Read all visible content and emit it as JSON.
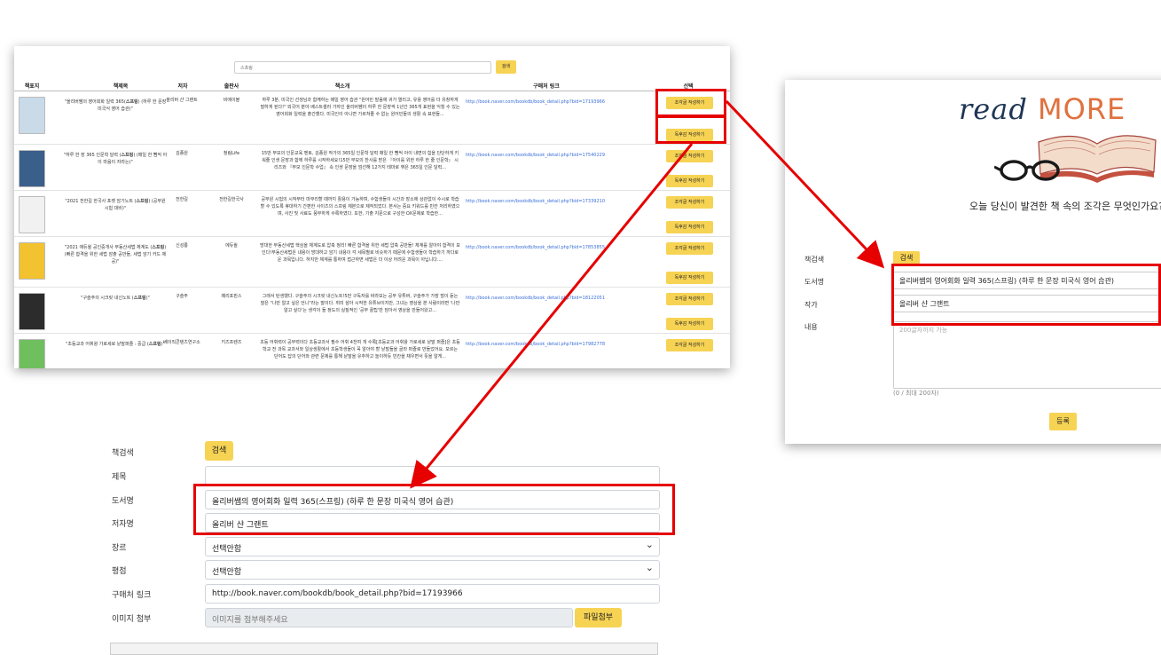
{
  "results": {
    "search_value": "스프링",
    "search_button": "검색",
    "headers": [
      "책표지",
      "책제목",
      "저자",
      "출판사",
      "책소개",
      "구매처 링크",
      "선택"
    ],
    "btn_snippet": "조각글 작성하기",
    "btn_review": "독후감 작성하기",
    "rows": [
      {
        "title": "\"올리버쌤의 영어회화 일력 365(스프링) (하루 한 문장 미국식 영어 습관)\"",
        "author": "올리버 샨 그랜트",
        "publisher": "비에이블",
        "intro": "하루 3분, 미국인 선생님과 함께하는 매일 영어 습관 \"원어민 발음에 귀가 열리고, 유용 영어를 더 유창하게 말하게 된다!\" 외국어 분야 베스트셀러 가자인 올리버쌤이 하루 한 문장씩 1년간 365개 표현을 익힐 수 있는 영어회화 일력을 출간했다. 미국인이 아니면 가르쳐줄 수 없는 원어민들의 생활 속 표현들...",
        "link": "http://book.naver.com/bookdb/book_detail.php?bid=17193966",
        "cover_color": "#c9dbe8"
      },
      {
        "title": "\"하루 한 장 365 인문학 달력 (스프링) (매일 한 뼘씩 아이 마음이 자라는)\"",
        "author": "김종원",
        "publisher": "청림Life",
        "intro": "15만 부모의 인문교육 멘토, 김종원 작가의 365일 인문학 달력 매일 한 뼘씩 아이 내면의 힘을 단단하게 키워줄 인생 문장과 함께 하루를 시작하세요!15만 부모의 찬사를 받은 『아이를 위한 하루 한 줄 인문학』 시리즈와 『부모 인문학 수업』 속 인생 문장을 엄선해 12가지 테마로 엮은 365일 인문 달력...",
        "link": "http://book.naver.com/bookdb/book_detail.php?bid=17540229",
        "cover_color": "#3a5f8a"
      },
      {
        "title": "\"2021 전한길 한국사 포켓 암기노트 (스프링) (공무원 시험 대비)\"",
        "author": "전한길",
        "publisher": "전한길한국사",
        "intro": "공무원 시험의 시작부터 마무리할 때까지 활용이 가능하며, 수험생들이 시간과 장소에 상관없이 수시로 학습할 수 있도록 휴대하기 간편한 사이즈의 스프링 제본으로 제작되었다. 본서는 중요 키워드를 빈칸 처리하였으며, 사진 및 사료도 풍부하게 수록하였다. 또한, 기출 지문으로 구성한 OX문제로 학습한...",
        "link": "http://book.naver.com/bookdb/book_detail.php?bid=17339210",
        "cover_color": "#f1f1f1"
      },
      {
        "title": "\"2021 에듀윌 공인중개사 부동산세법 체계도 (스프링) (빠른 합격을 위한 세법 암출 공만들, 세법 암기 카드 제공)\"",
        "author": "신성룡",
        "publisher": "에듀윌",
        "intro": "방대한 부동산세법 핵심을 체계도로 압축 정리! 빠른 합격을 위한 세법 압축 공만들! 체계를 알아야 합격이 보인다!부동산세법은 내용이 방대하고 암기 내용이 각 세목별로 비슷하기 때문에 수험생들이 학습하기 까다로운 과목입니다. 하지만 체계를 통하여 접근하면 세법은 더 이상 어려운 과목이 아닙니다....",
        "link": "http://book.naver.com/bookdb/book_detail.php?bid=17853855",
        "cover_color": "#f2c230"
      },
      {
        "title": "\"구슬주의 시크릿 내신노트 (스프링)\"",
        "author": "구슬주",
        "publisher": "메리포핀스",
        "intro": "그래서 탄생했다. 구슬주의 시크릿 내신노트!5만 구독자를 바라보는 공부 유튜버, 구슬주가 가장 많이 듣는 말은 \"나만 알고 싶은 언니\"라는 말이다. 취미 삼아 시작한 유튜브이지만, 그녀는 영상을 본 사람이라면 '나만 알고 싶다'는 생각이 들 정도의 실질적인 '공부 꿀팁'만 담아서 영상을 만들어왔고...",
        "link": "http://book.naver.com/bookdb/book_detail.php?bid=18122051",
        "cover_color": "#2c2c2c"
      },
      {
        "title": "\"초등교과 어휘왕 가로세로 낱말퍼즐 : 중급 (스프링)\"",
        "author": "베이직콘텐츠연구소",
        "publisher": "키즈프렌즈",
        "intro": "초등 어휘력이 공부력이다 초등교과서 필수 어휘 4천여 개 수록[초등교과 어휘왕 가로세로 낱말 퍼즐]은 초등학교 전 과목 교과서와 일상생활에서 초등학생들이 꼭 알아야 할 낱말들을 골라 퍼즐로 만들었어요. 모르는 단어도 답의 단어와 관련 문제를 통해 낱말을 유추하고 놀이하듯 빈칸을 채우면서 뜻을 알게...",
        "link": "http://book.naver.com/bookdb/book_detail.php?bid=17982778",
        "cover_color": "#6fbf5f"
      }
    ]
  },
  "readmore": {
    "logo_read": "read",
    "logo_more": "MORE",
    "tagline": "오늘 당신이 발견한 책 속의 조각은 무엇인가요?",
    "label_search": "책검색",
    "search_button": "검색",
    "label_book": "도서명",
    "book_value": "올리버쌤의 영어회화 일력 365(스프링) (하루 한 문장 미국식 영어 습관)",
    "label_author": "작가",
    "author_value": "올리버 샨 그랜트",
    "label_content": "내용",
    "content_placeholder": "200글자까지 가능",
    "counter": "(0 / 최대 200자)",
    "submit": "등록"
  },
  "form": {
    "label_search": "책검색",
    "search_button": "검색",
    "label_title": "제목",
    "label_book": "도서명",
    "book_value": "올리버쌤의 영어회화 일력 365(스프링) (하루 한 문장 미국식 영어 습관)",
    "label_author": "저자명",
    "author_value": "올리버 샨 그랜트",
    "label_genre": "장르",
    "genre_value": "선택안함",
    "label_rating": "평점",
    "rating_value": "선택안함",
    "label_link": "구매처 링크",
    "link_value": "http://book.naver.com/bookdb/book_detail.php?bid=17193966",
    "label_image": "이미지 첨부",
    "image_placeholder": "이미지를 첨부해주세요",
    "file_button": "파일첨부"
  },
  "colors": {
    "accent_yellow": "#f7d354",
    "highlight_red": "#e60000",
    "link_blue": "#3b6fd8",
    "logo_navy": "#1f3556",
    "logo_orange": "#e0713f"
  }
}
